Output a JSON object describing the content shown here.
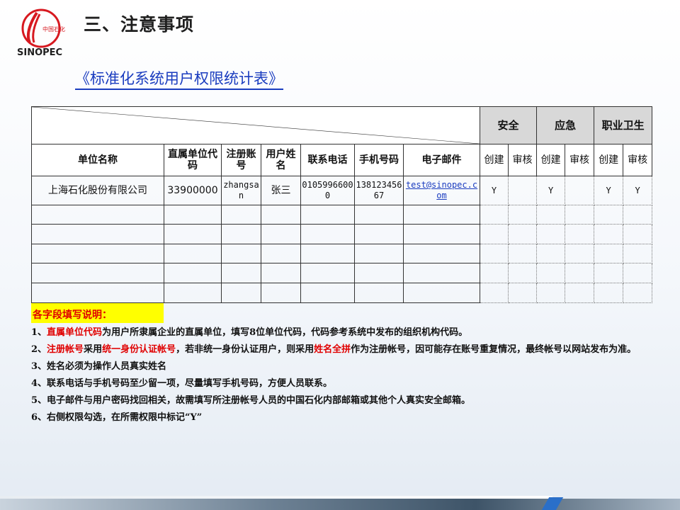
{
  "header": {
    "title": "三、注意事项",
    "logo_text": "中国石化",
    "logo_brand": "SINOPEC"
  },
  "doc_link": "《标准化系统用户权限统计表》",
  "table": {
    "group_headers": [
      "安全",
      "应急",
      "职业卫生"
    ],
    "columns": [
      "单位名称",
      "直属单位代码",
      "注册账号",
      "用户姓名",
      "联系电话",
      "手机号码",
      "电子邮件"
    ],
    "sub_headers": [
      "创建",
      "审核",
      "创建",
      "审核",
      "创建",
      "审核"
    ],
    "sample_row": {
      "unit_name": "上海石化股份有限公司",
      "unit_code": "33900000",
      "account": "zhangsan",
      "user_name": "张三",
      "phone": "01059966000",
      "mobile": "13812345667",
      "email": "test@sinopec.com",
      "perms": [
        "Y",
        "",
        "Y",
        "",
        "Y",
        "Y"
      ]
    }
  },
  "notes": {
    "heading": "各字段填写说明：",
    "n1_pre": "1、",
    "n1_hl": "直属单位代码",
    "n1_rest": "为用户所隶属企业的直属单位，填写8位单位代码，代码参考系统中发布的组织机构代码。",
    "n2_pre": "2、",
    "n2_hl1": "注册帐号",
    "n2_mid1": "采用",
    "n2_hl2": "统一身份认证帐号",
    "n2_mid2": "，若非统一身份认证用户，则采用",
    "n2_hl3": "姓名全拼",
    "n2_rest": "作为注册帐号，因可能存在账号重复情况，最终帐号以网站发布为准。",
    "n3": "3、姓名必须为操作人员真实姓名",
    "n4": "4、联系电话与手机号码至少留一项，尽量填写手机号码，方便人员联系。",
    "n5": "5、电子邮件与用户密码找回相关，故需填写所注册帐号人员的中国石化内部邮箱或其他个人真实安全邮箱。",
    "n6": "6、右侧权限勾选，在所需权限中标记“Y”"
  },
  "colors": {
    "title_link": "#1a3cbf",
    "highlight_red": "#e00000",
    "notes_heading_bg": "#ffff00",
    "group_header_bg": "#d8d8d8",
    "logo_red": "#d71920"
  }
}
